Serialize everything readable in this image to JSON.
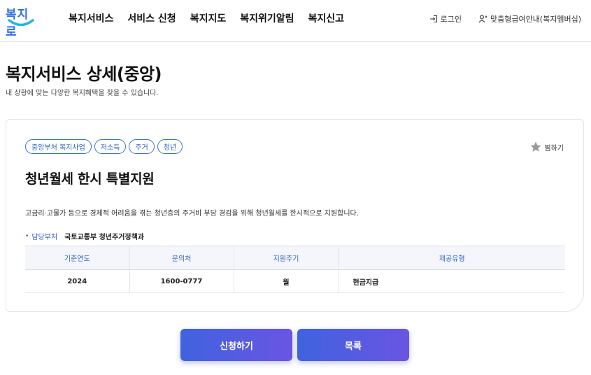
{
  "header": {
    "logo_text": "복지로",
    "nav": [
      "복지서비스",
      "서비스 신청",
      "복지지도",
      "복지위기알림",
      "복지신고"
    ],
    "login_label": "로그인",
    "membership_label": "맞춤형급여안내(복지멤버십)",
    "icons": {
      "login": "login-icon",
      "membership": "user-add-icon"
    }
  },
  "page": {
    "title": "복지서비스 상세(중앙)",
    "description": "내 상황에 맞는 다양한 복지혜택을 찾을 수 있습니다."
  },
  "detail": {
    "tags": [
      "중앙부처 복지사업",
      "저소득",
      "주거",
      "청년"
    ],
    "bookmark_label": "찜하기",
    "title": "청년월세 한시 특별지원",
    "description": "고금리·고물가 등으로 경제적 어려움을 겪는 청년층의 주거비 부담 경감을 위해 청년월세를 한시적으로 지원합니다.",
    "dept_label": "담당부처",
    "dept_value": "국토교통부 청년주거정책과",
    "table": {
      "headers": [
        "기준연도",
        "문의처",
        "지원주기",
        "제공유형"
      ],
      "row": [
        "2024",
        "1600-0777",
        "월",
        "현금지급"
      ]
    }
  },
  "buttons": {
    "apply_label": "신청하기",
    "list_label": "목록"
  },
  "colors": {
    "accent": "#2d5fc4",
    "button_start": "#3f63df",
    "button_end": "#6a55e2"
  }
}
